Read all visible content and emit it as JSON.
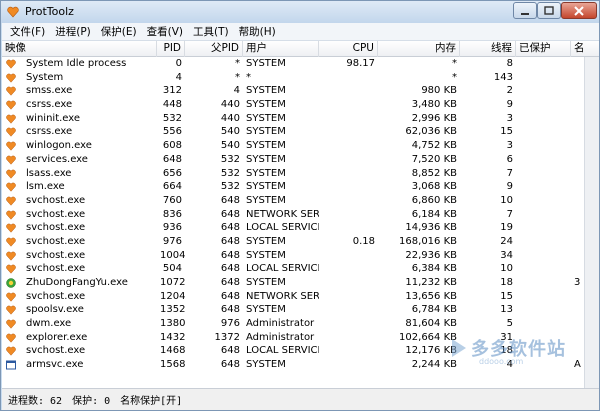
{
  "window": {
    "title": "ProtToolz"
  },
  "menu": [
    "文件(F)",
    "进程(P)",
    "保护(E)",
    "查看(V)",
    "工具(T)",
    "帮助(H)"
  ],
  "columns": {
    "name": "映像",
    "pid": "PID",
    "ppid": "父PID",
    "user": "用户",
    "cpu": "CPU",
    "mem": "内存",
    "threads": "线程",
    "protected": "已保护",
    "extra": "名"
  },
  "processes": [
    {
      "name": "System Idle process",
      "pid": "0",
      "ppid": "*",
      "user": "SYSTEM",
      "cpu": "98.17",
      "mem": "*",
      "threads": "8",
      "icon": "orange-heart-icon",
      "extra": ""
    },
    {
      "name": "System",
      "pid": "4",
      "ppid": "*",
      "user": "*",
      "cpu": "",
      "mem": "*",
      "threads": "143",
      "icon": "orange-heart-icon",
      "extra": ""
    },
    {
      "name": "smss.exe",
      "pid": "312",
      "ppid": "4",
      "user": "SYSTEM",
      "cpu": "",
      "mem": "980 KB",
      "threads": "2",
      "icon": "orange-heart-icon",
      "extra": ""
    },
    {
      "name": "csrss.exe",
      "pid": "448",
      "ppid": "440",
      "user": "SYSTEM",
      "cpu": "",
      "mem": "3,480 KB",
      "threads": "9",
      "icon": "orange-heart-icon",
      "extra": ""
    },
    {
      "name": "wininit.exe",
      "pid": "532",
      "ppid": "440",
      "user": "SYSTEM",
      "cpu": "",
      "mem": "2,996 KB",
      "threads": "3",
      "icon": "orange-heart-icon",
      "extra": ""
    },
    {
      "name": "csrss.exe",
      "pid": "556",
      "ppid": "540",
      "user": "SYSTEM",
      "cpu": "",
      "mem": "62,036 KB",
      "threads": "15",
      "icon": "orange-heart-icon",
      "extra": ""
    },
    {
      "name": "winlogon.exe",
      "pid": "608",
      "ppid": "540",
      "user": "SYSTEM",
      "cpu": "",
      "mem": "4,752 KB",
      "threads": "3",
      "icon": "orange-heart-icon",
      "extra": ""
    },
    {
      "name": "services.exe",
      "pid": "648",
      "ppid": "532",
      "user": "SYSTEM",
      "cpu": "",
      "mem": "7,520 KB",
      "threads": "6",
      "icon": "orange-heart-icon",
      "extra": ""
    },
    {
      "name": "lsass.exe",
      "pid": "656",
      "ppid": "532",
      "user": "SYSTEM",
      "cpu": "",
      "mem": "8,852 KB",
      "threads": "7",
      "icon": "orange-heart-icon",
      "extra": ""
    },
    {
      "name": "lsm.exe",
      "pid": "664",
      "ppid": "532",
      "user": "SYSTEM",
      "cpu": "",
      "mem": "3,068 KB",
      "threads": "9",
      "icon": "orange-heart-icon",
      "extra": ""
    },
    {
      "name": "svchost.exe",
      "pid": "760",
      "ppid": "648",
      "user": "SYSTEM",
      "cpu": "",
      "mem": "6,860 KB",
      "threads": "10",
      "icon": "orange-heart-icon",
      "extra": ""
    },
    {
      "name": "svchost.exe",
      "pid": "836",
      "ppid": "648",
      "user": "NETWORK SER...",
      "cpu": "",
      "mem": "6,184 KB",
      "threads": "7",
      "icon": "orange-heart-icon",
      "extra": ""
    },
    {
      "name": "svchost.exe",
      "pid": "936",
      "ppid": "648",
      "user": "LOCAL SERVICE",
      "cpu": "",
      "mem": "14,936 KB",
      "threads": "19",
      "icon": "orange-heart-icon",
      "extra": ""
    },
    {
      "name": "svchost.exe",
      "pid": "976",
      "ppid": "648",
      "user": "SYSTEM",
      "cpu": "0.18",
      "mem": "168,016 KB",
      "threads": "24",
      "icon": "orange-heart-icon",
      "extra": ""
    },
    {
      "name": "svchost.exe",
      "pid": "1004",
      "ppid": "648",
      "user": "SYSTEM",
      "cpu": "",
      "mem": "22,936 KB",
      "threads": "34",
      "icon": "orange-heart-icon",
      "extra": ""
    },
    {
      "name": "svchost.exe",
      "pid": "504",
      "ppid": "648",
      "user": "LOCAL SERVICE",
      "cpu": "",
      "mem": "6,384 KB",
      "threads": "10",
      "icon": "orange-heart-icon",
      "extra": ""
    },
    {
      "name": "ZhuDongFangYu.exe",
      "pid": "1072",
      "ppid": "648",
      "user": "SYSTEM",
      "cpu": "",
      "mem": "11,232 KB",
      "threads": "18",
      "icon": "shield-360-icon",
      "extra": "3"
    },
    {
      "name": "svchost.exe",
      "pid": "1204",
      "ppid": "648",
      "user": "NETWORK SER...",
      "cpu": "",
      "mem": "13,656 KB",
      "threads": "15",
      "icon": "orange-heart-icon",
      "extra": ""
    },
    {
      "name": "spoolsv.exe",
      "pid": "1352",
      "ppid": "648",
      "user": "SYSTEM",
      "cpu": "",
      "mem": "6,784 KB",
      "threads": "13",
      "icon": "orange-heart-icon",
      "extra": ""
    },
    {
      "name": "dwm.exe",
      "pid": "1380",
      "ppid": "976",
      "user": "Administrator",
      "cpu": "",
      "mem": "81,604 KB",
      "threads": "5",
      "icon": "orange-heart-icon",
      "extra": ""
    },
    {
      "name": "explorer.exe",
      "pid": "1432",
      "ppid": "1372",
      "user": "Administrator",
      "cpu": "",
      "mem": "102,664 KB",
      "threads": "31",
      "icon": "orange-heart-icon",
      "extra": ""
    },
    {
      "name": "svchost.exe",
      "pid": "1468",
      "ppid": "648",
      "user": "LOCAL SERVICE",
      "cpu": "",
      "mem": "12,176 KB",
      "threads": "18",
      "icon": "orange-heart-icon",
      "extra": ""
    },
    {
      "name": "armsvc.exe",
      "pid": "1568",
      "ppid": "648",
      "user": "SYSTEM",
      "cpu": "",
      "mem": "2,244 KB",
      "threads": "4",
      "icon": "window-icon",
      "extra": "A"
    }
  ],
  "status": {
    "process_count": "进程数: 62",
    "protected_count": "保护: 0",
    "protect_by_name": "名称保护[开]"
  },
  "watermark": {
    "text": "多多软件站",
    "sub": "ddooo.com"
  },
  "colors": {
    "titlebar": "#c9dcef",
    "close": "#c4462c",
    "icon": "#f08a24"
  }
}
